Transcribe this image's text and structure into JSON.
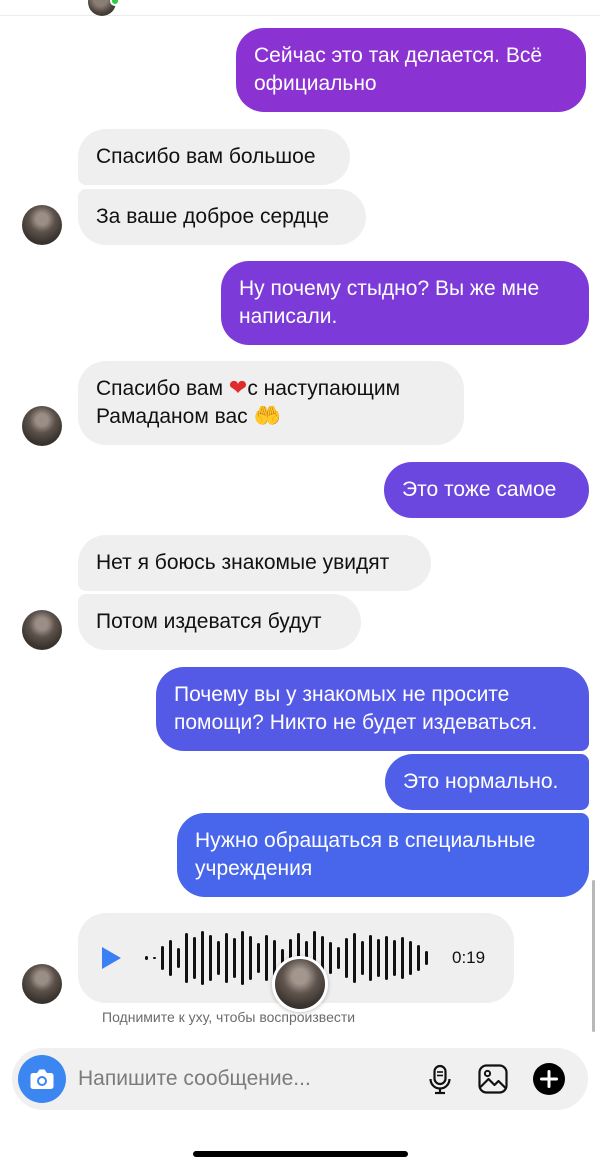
{
  "colors": {
    "incoming_bg": "#efefef",
    "outgoing_purple": "#8a33d2",
    "outgoing_violet": "#6b47e0",
    "outgoing_blue": "#4f5fe8",
    "accent_blue": "#3b7ff5"
  },
  "messages": [
    {
      "side": "out",
      "text": "Сейчас это так делается. Всё официально"
    },
    {
      "side": "in",
      "text": "Спасибо вам большое"
    },
    {
      "side": "in",
      "text": "За ваше доброе сердце"
    },
    {
      "side": "out",
      "text": "Ну почему стыдно? Вы же мне написали."
    },
    {
      "side": "in",
      "text_before": "Спасибо вам",
      "emoji_heart": "❤",
      "text_after": "с наступающим",
      "text_line2": "Рамаданом вас",
      "emoji_hands": "🤲"
    },
    {
      "side": "out",
      "text": "Это тоже самое"
    },
    {
      "side": "in",
      "text": "Нет я боюсь знакомые увидят"
    },
    {
      "side": "in",
      "text": "Потом издеватся будут"
    },
    {
      "side": "out",
      "text": "Почему вы у знакомых не просите помощи? Никто не будет издеваться."
    },
    {
      "side": "out",
      "text": "Это нормально."
    },
    {
      "side": "out",
      "text": "Нужно обращаться в специальные учреждения"
    }
  ],
  "voice_message": {
    "duration": "0:19",
    "hint": "Поднимите к уху, чтобы воспроизвести",
    "play_icon": "play-icon"
  },
  "composer": {
    "placeholder": "Напишите сообщение...",
    "icons": [
      "camera-icon",
      "microphone-icon",
      "gallery-icon",
      "plus-icon"
    ]
  }
}
